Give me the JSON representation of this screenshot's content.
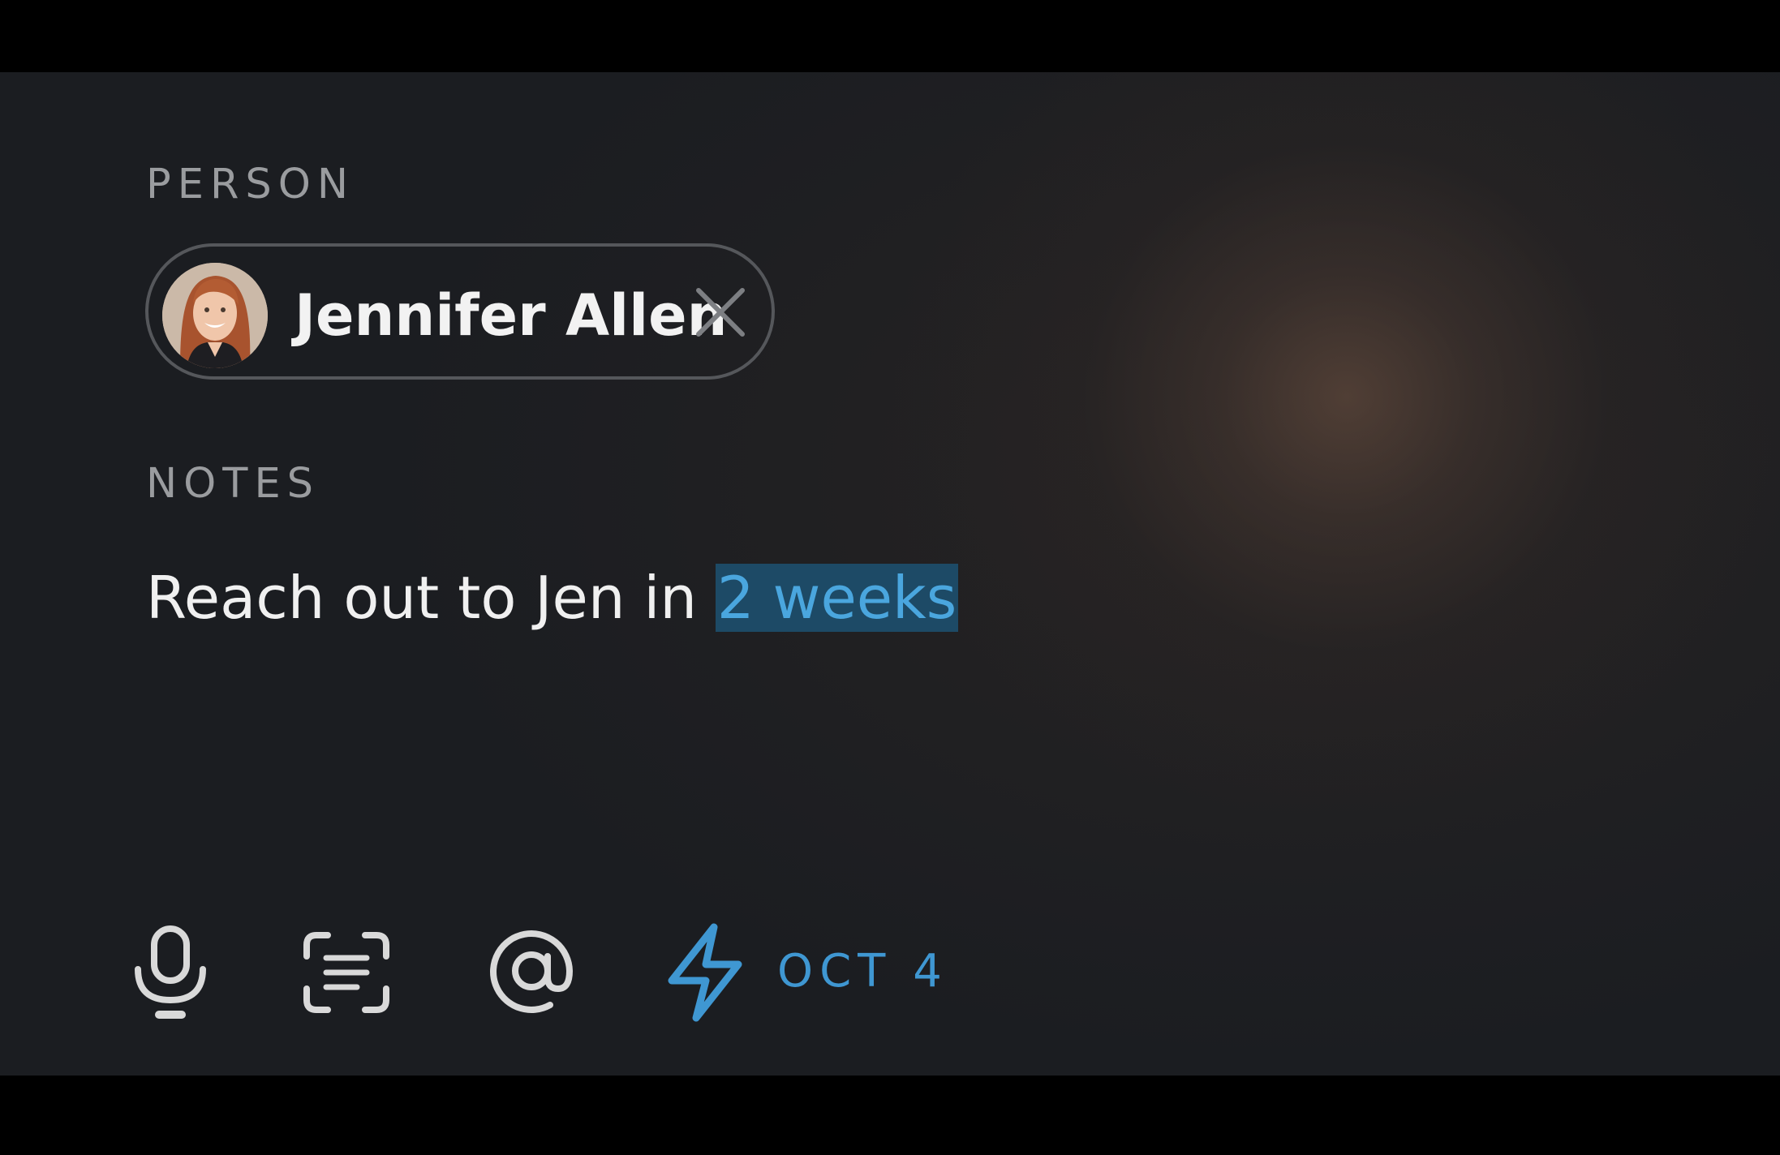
{
  "person_section": {
    "label": "PERSON",
    "chip": {
      "name": "Jennifer Allen"
    }
  },
  "notes_section": {
    "label": "NOTES",
    "text_before": "Reach out to Jen in ",
    "highlighted_text": "2 weeks"
  },
  "toolbar": {
    "icons": [
      "microphone-icon",
      "scan-text-icon",
      "at-sign-icon",
      "lightning-bolt-icon"
    ],
    "reminder_date": "OCT 4"
  },
  "colors": {
    "accent": "#3f97d2",
    "highlight_bg": "#1d4a66",
    "label": "#9a9c9f",
    "text": "#f0f0f0",
    "background": "#1b1d21"
  }
}
